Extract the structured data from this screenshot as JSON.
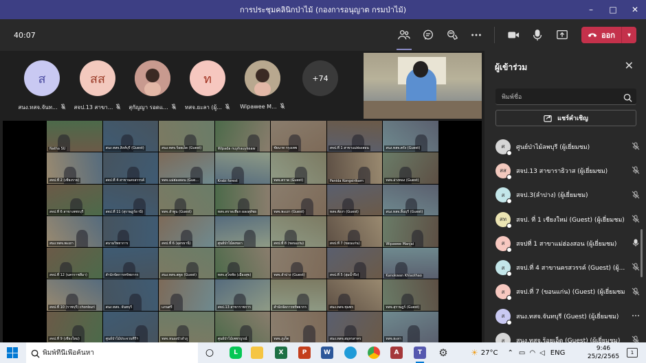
{
  "window": {
    "title": "การประชุมคลินิกป่าไม้ (กองการอนุญาต กรมป่าไม้)",
    "controls": [
      "–",
      "□",
      "✕"
    ]
  },
  "meeting": {
    "timer": "40:07",
    "leave_label": "ออก",
    "toolbar_icons": [
      "people-icon",
      "chat-icon",
      "reactions-icon",
      "more-icon",
      "camera-icon",
      "mic-icon",
      "share-icon"
    ]
  },
  "stage": {
    "avatars": [
      {
        "initials": "ส",
        "name": "สนง.ทสจ.จันท...",
        "bg": "#c9c9f2",
        "fg": "#4b4ba0"
      },
      {
        "initials": "สส",
        "name": "สจป.13 สาขา...",
        "bg": "#f3c9be",
        "fg": "#9a3b28"
      },
      {
        "initials": "",
        "name": "สุกัญญา รอดแ...",
        "bg": "#c89a8f",
        "fg": "#000"
      },
      {
        "initials": "ท",
        "name": "ทสจ.ยะลา (ผู้...",
        "bg": "#f6c7bf",
        "fg": "#a23523"
      },
      {
        "initials": "",
        "name": "Wipawee M...",
        "bg": "#b8a88f",
        "fg": "#000"
      }
    ],
    "overflow_count": "+74",
    "grid_tiles": [
      "Natha SU",
      "สนง.ทสจ.สิงห์บุรี (Guest)",
      "สนง.ทสจ.ร้อยเอ็ด (Guest)",
      "Wipada nuyhauykeaw",
      "ชัยนาท กรุงเทพ",
      "สจป.ที่ 1 สาขาแม่ฮ่องสอน",
      "สนง.ทสจ.ตรัง (Guest)",
      "สจป.ที่ 2 (เชียงราย)",
      "สจป.ที่ 4 สาขานครสวรรค์",
      "ทสจ.แม่ฮ่องสอน (Gue...",
      "Krabi forest",
      "ทสจ.ตราด (Guest)",
      "Panida Kongsirikarn",
      "ทสจ.อ่างทอง (Guest)",
      "สจป.ที่ 6 สาขาเพชรบุรี",
      "สจป.ที่ 11 (สุราษฎร์ธานี)",
      "ทสจ.ลำพูน (Guest)",
      "ทสจ.ตราดเทือก ผลงสุลัชย",
      "ทสจ.พะเยา (Guest)",
      "ทสจ.พังงา (Guest)",
      "สนง.ทสจ.ลิ้นบุรี (Guest)",
      "สนง.ทสจ.พะเยา",
      "สนามวิทยาการ",
      "สจป.ที่ 6 (อุดรธานี)",
      "ศูนย์ป่าไม้สงขลา",
      "สจป.ที่ 8 (ขอนแก่น)",
      "สจป.ที่ 7 (ขอนแก่น)",
      "Wipawee Manjai",
      "สจป.ที่ 12 (นครราชสีมา)",
      "สำนักจัดการทรัพยากร",
      "สนง.ทสจ.สตูล (Guest)",
      "ทสจ.สุโขทัย (เมืองสุข)",
      "ทสจ.ลำปาง (Guest)",
      "สจป.ที่ 5 (ลุ่มน้ำปิง)",
      "Kanokwan Khlaothao",
      "สจป.ที่ 10 (ราชบุรี) chonburi",
      "สนง.ทสจ. จันทบุรี",
      "แกนศรี",
      "สจป.13 สาขาราชการ",
      "สำนักจัดการทรัพยากร",
      "สนง.ทสจ.ชุมพร",
      "ทสจ.สุราษฎร์ (Guest)",
      "สจป.ที่ 9 (เชียงใหม่)",
      "ศูนย์ป่าไม้ประจวบคีรีฯ",
      "ทสจ.หนองบัวลำภู",
      "ศูนย์ป่าไม้เพชรบูรณ์",
      "ทสจ.ภูเก็ต",
      "สนง.ทสจ.สมุทรสาคร",
      "ทสจ.ยะลา"
    ]
  },
  "panel": {
    "title": "ผู้เข้าร่วม",
    "search_placeholder": "พิมพ์ชื่อ",
    "share_invite_label": "แชร์คำเชิญ",
    "participants": [
      {
        "initials": "ศ",
        "name": "ศูนย์ป่าไม้ลพบุรี (ผู้เยี่ยมชม)",
        "bg": "#d6d6d6",
        "status": "mic-off-icon"
      },
      {
        "initials": "สส",
        "name": "สจป.13 สาขาราธิวาส (ผู้เยี่ยมชม)",
        "bg": "#f3c9be",
        "status": "mic-off-icon"
      },
      {
        "initials": "ส",
        "name": "สจป.3(ลำปาง) (ผู้เยี่ยมชม)",
        "bg": "#c3e6e9",
        "status": "mic-off-icon"
      },
      {
        "initials": "สท",
        "name": "สจป. ที่ 1 เชียงใหม่ (Guest) (ผู้เยี่ยมชม)",
        "bg": "#ece5b3",
        "status": "mic-off-icon"
      },
      {
        "initials": "ส",
        "name": "สจปที่ 1 สาขาแม่ฮ่องสอน (ผู้เยี่ยมชม)",
        "bg": "#f7c8c0",
        "status": "mic-on-icon"
      },
      {
        "initials": "ส",
        "name": "สจป.ที่ 4 สาขานครสวรรค์ (Guest) (ผู้...",
        "bg": "#c3e6e9",
        "status": "mic-off-icon"
      },
      {
        "initials": "ส",
        "name": "สจป.ที่ 7 (ขอนแก่น) (Guest) (ผู้เยี่ยมชม",
        "bg": "#f7c8c0",
        "status": "mic-off-icon"
      },
      {
        "initials": "ส",
        "name": "สนง.ทสจ.จันทบุรี (Guest) (ผู้เยี่ยมชม)",
        "bg": "#c9c9f2",
        "status": "more-icon"
      },
      {
        "initials": "ส",
        "name": "สนง.ทสจ.ร้อยเอ็ด (Guest) (ผู้เยี่ยมชม)",
        "bg": "#d6d6d6",
        "status": "mic-off-icon"
      }
    ]
  },
  "taskbar": {
    "search_placeholder": "พิมพ์ที่นี่เพื่อค้นหา",
    "weather": "27°C",
    "language": "ENG",
    "time": "9:46",
    "date": "25/2/2565",
    "notification_count": "1",
    "apps": [
      "task-view-icon",
      "line-icon",
      "file-explorer-icon",
      "excel-icon",
      "powerpoint-icon",
      "word-icon",
      "edge-icon",
      "chrome-icon",
      "access-icon",
      "teams-icon",
      "settings-icon"
    ]
  }
}
